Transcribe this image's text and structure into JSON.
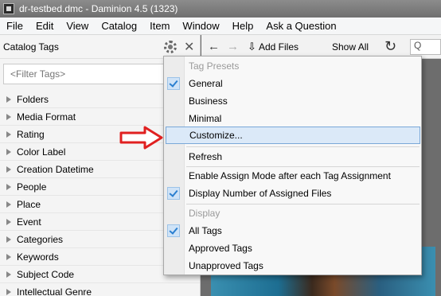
{
  "titlebar": {
    "title": "dr-testbed.dmc - Daminion 4.5 (1323)"
  },
  "menubar": {
    "items": [
      "File",
      "Edit",
      "View",
      "Catalog",
      "Item",
      "Window",
      "Help",
      "Ask a Question"
    ]
  },
  "left_panel": {
    "title": "Catalog Tags",
    "filter_placeholder": "<Filter Tags>",
    "items": [
      "Folders",
      "Media Format",
      "Rating",
      "Color Label",
      "Creation Datetime",
      "People",
      "Place",
      "Event",
      "Categories",
      "Keywords",
      "Subject Code",
      "Intellectual Genre"
    ]
  },
  "toolbar": {
    "add_files": "Add Files",
    "show_all": "Show All",
    "search_placeholder": "Q"
  },
  "dropdown": {
    "section_tag_presets": "Tag Presets",
    "general": "General",
    "business": "Business",
    "minimal": "Minimal",
    "customize": "Customize...",
    "refresh": "Refresh",
    "enable_assign": "Enable Assign Mode after each Tag Assignment",
    "display_number": "Display Number of Assigned Files",
    "section_display": "Display",
    "all_tags": "All Tags",
    "approved_tags": "Approved Tags",
    "unapproved_tags": "Unapproved Tags"
  },
  "colors": {
    "accent": "#2a7fd0",
    "highlight": "#dbe9f8",
    "arrow": "#e02020"
  }
}
